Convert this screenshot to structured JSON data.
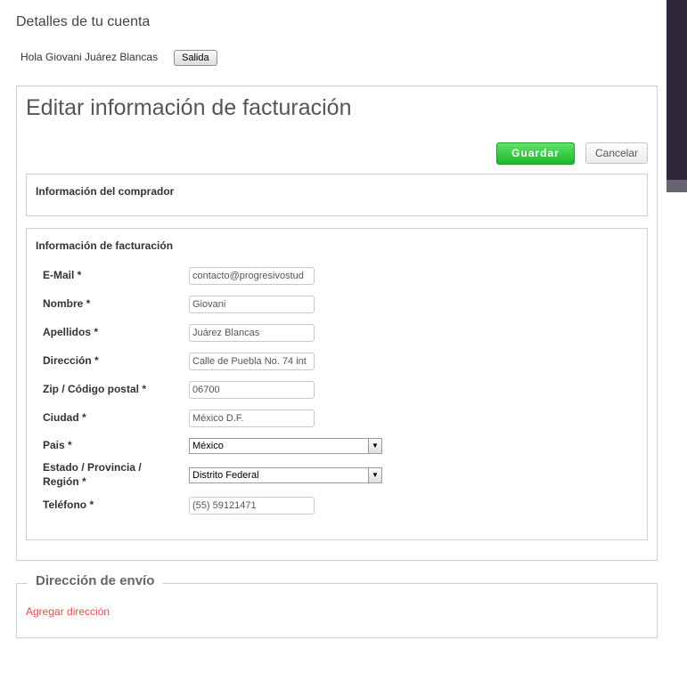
{
  "account": {
    "title": "Detalles de tu cuenta",
    "greeting": "Hola Giovani Juárez Blancas",
    "logout_label": "Salida"
  },
  "billing_panel": {
    "title": "Editar información de facturación",
    "save_label": "Guardar",
    "cancel_label": "Cancelar"
  },
  "buyer_section": {
    "title": "Información del comprador"
  },
  "billing_section": {
    "title": "Información de facturación",
    "email": {
      "label": "E-Mail *",
      "value": "contacto@progresivostud"
    },
    "first_name": {
      "label": "Nombre *",
      "value": "Giovani"
    },
    "last_name": {
      "label": "Apellidos *",
      "value": "Juárez Blancas"
    },
    "address": {
      "label": "Dirección *",
      "value": "Calle de Puebla No. 74 int"
    },
    "zip": {
      "label": "Zip / Código postal *",
      "value": "06700"
    },
    "city": {
      "label": "Ciudad *",
      "value": "México D.F."
    },
    "country": {
      "label": "Pais *",
      "value": "México"
    },
    "state": {
      "label_line1": "Estado / Provincia /",
      "label_line2": "Región *",
      "value": "Distrito Federal"
    },
    "phone": {
      "label": "Teléfono *",
      "value": "(55) 59121471"
    }
  },
  "shipping_section": {
    "title": "Dirección de envío",
    "add_link": "Agregar dirección"
  },
  "colors": {
    "save_green": "#2ec33b",
    "link_red": "#e5484d",
    "sidebar_dark": "#2e2538"
  }
}
